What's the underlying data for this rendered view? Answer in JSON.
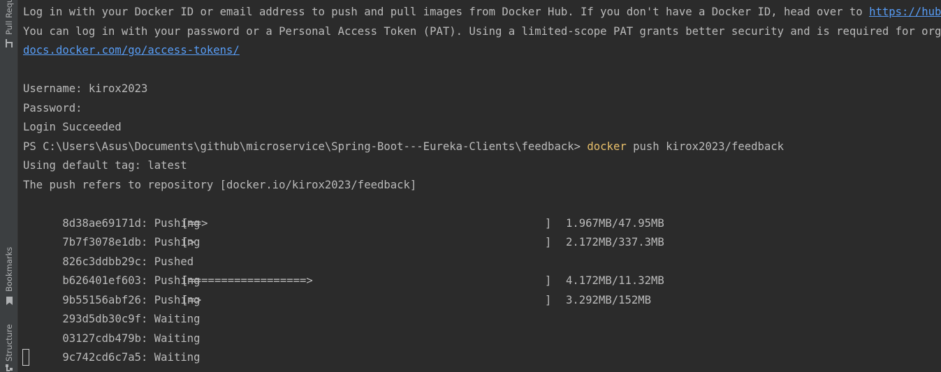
{
  "sidebar": {
    "pull_requests_label": "Pull Requests",
    "bookmarks_label": "Bookmarks",
    "structure_label": "Structure"
  },
  "terminal": {
    "login_line_1": "Log in with your Docker ID or email address to push and pull images from Docker Hub. If you don't have a Docker ID, head over to ",
    "login_line_1_link": "https://hub.docker.com",
    "login_line_2": "You can log in with your password or a Personal Access Token (PAT). Using a limited-scope PAT grants better security and is required for organizations using SSO. Learn more at https://",
    "access_tokens_link": "docs.docker.com/go/access-tokens/",
    "username_line": "Username: kirox2023",
    "password_line": "Password:",
    "login_result": "Login Succeeded",
    "prompt": "PS C:\\Users\\Asus\\Documents\\github\\microservice\\Spring-Boot---Eureka-Clients\\feedback> ",
    "command_keyword": "docker",
    "command_args": " push kirox2023/feedback",
    "default_tag_line": "Using default tag: latest",
    "repository_line": "The push refers to repository [docker.io/kirox2023/feedback]",
    "layers": [
      {
        "id_status": "8d38ae69171d: Pushing ",
        "bar": "[==>",
        "close": "]",
        "size": "1.967MB/47.95MB"
      },
      {
        "id_status": "7b7f3078e1db: Pushing ",
        "bar": "[>",
        "close": "]",
        "size": "2.172MB/337.3MB"
      },
      {
        "id_status": "826c3ddbb29c: Pushed",
        "bar": "",
        "close": "",
        "size": ""
      },
      {
        "id_status": "b626401ef603: Pushing ",
        "bar": "[==================>",
        "close": "]",
        "size": "4.172MB/11.32MB"
      },
      {
        "id_status": "9b55156abf26: Pushing ",
        "bar": "[=>",
        "close": "]",
        "size": "3.292MB/152MB"
      },
      {
        "id_status": "293d5db30c9f: Waiting",
        "bar": "",
        "close": "",
        "size": ""
      },
      {
        "id_status": "03127cdb479b: Waiting",
        "bar": "",
        "close": "",
        "size": ""
      },
      {
        "id_status": "9c742cd6c7a5: Waiting",
        "bar": "",
        "close": "",
        "size": ""
      }
    ]
  },
  "colors": {
    "background": "#2b2b2b",
    "text": "#bbbbbb",
    "link": "#589df6",
    "command_highlight": "#e8bf6a",
    "sidebar": "#3c3f41"
  }
}
